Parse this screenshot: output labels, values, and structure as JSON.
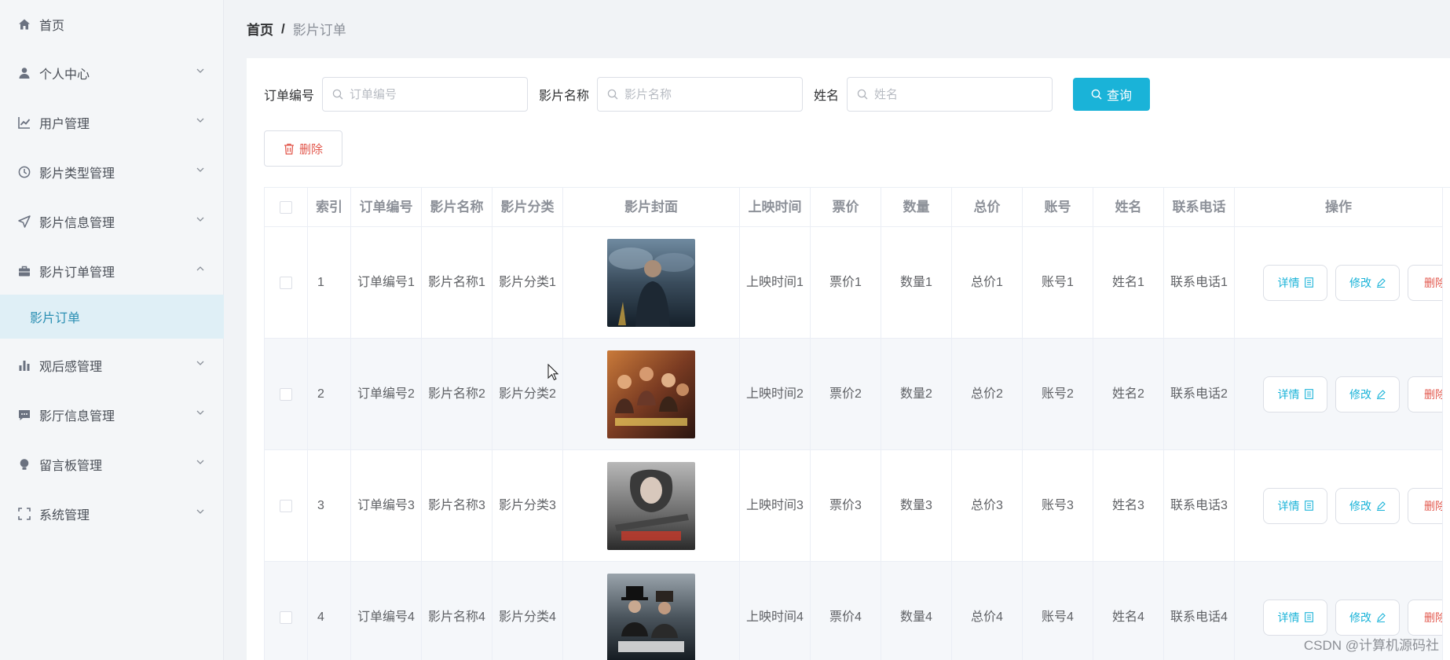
{
  "sidebar": {
    "items": [
      {
        "label": "首页",
        "icon": "home-icon"
      },
      {
        "label": "个人中心",
        "icon": "user-icon"
      },
      {
        "label": "用户管理",
        "icon": "chart-line-icon"
      },
      {
        "label": "影片类型管理",
        "icon": "clock-icon"
      },
      {
        "label": "影片信息管理",
        "icon": "send-icon"
      },
      {
        "label": "影片订单管理",
        "icon": "briefcase-icon"
      },
      {
        "label": "观后感管理",
        "icon": "bar-chart-icon"
      },
      {
        "label": "影厅信息管理",
        "icon": "chat-icon"
      },
      {
        "label": "留言板管理",
        "icon": "bulb-icon"
      },
      {
        "label": "系统管理",
        "icon": "fullscreen-icon"
      }
    ],
    "active_sub": "影片订单"
  },
  "breadcrumb": {
    "home": "首页",
    "separator": "/",
    "current": "影片订单"
  },
  "search": {
    "order_no_label": "订单编号",
    "order_no_placeholder": "订单编号",
    "movie_name_label": "影片名称",
    "movie_name_placeholder": "影片名称",
    "name_label": "姓名",
    "name_placeholder": "姓名",
    "query_label": "查询"
  },
  "toolbar": {
    "delete_label": "删除"
  },
  "table": {
    "headers": [
      "",
      "索引",
      "订单编号",
      "影片名称",
      "影片分类",
      "影片封面",
      "上映时间",
      "票价",
      "数量",
      "总价",
      "账号",
      "姓名",
      "联系电话",
      "操作"
    ],
    "rows": [
      {
        "index": "1",
        "order_no": "订单编号1",
        "movie_name": "影片名称1",
        "category": "影片分类1",
        "release": "上映时间1",
        "price": "票价1",
        "qty": "数量1",
        "total": "总价1",
        "account": "账号1",
        "name": "姓名1",
        "phone": "联系电话1"
      },
      {
        "index": "2",
        "order_no": "订单编号2",
        "movie_name": "影片名称2",
        "category": "影片分类2",
        "release": "上映时间2",
        "price": "票价2",
        "qty": "数量2",
        "total": "总价2",
        "account": "账号2",
        "name": "姓名2",
        "phone": "联系电话2"
      },
      {
        "index": "3",
        "order_no": "订单编号3",
        "movie_name": "影片名称3",
        "category": "影片分类3",
        "release": "上映时间3",
        "price": "票价3",
        "qty": "数量3",
        "total": "总价3",
        "account": "账号3",
        "name": "姓名3",
        "phone": "联系电话3"
      },
      {
        "index": "4",
        "order_no": "订单编号4",
        "movie_name": "影片名称4",
        "category": "影片分类4",
        "release": "上映时间4",
        "price": "票价4",
        "qty": "数量4",
        "total": "总价4",
        "account": "账号4",
        "name": "姓名4",
        "phone": "联系电话4"
      }
    ],
    "actions": {
      "detail": "详情",
      "edit": "修改",
      "remove": "删除"
    }
  },
  "watermark": "CSDN @计算机源码社",
  "colors": {
    "accent": "#1ab3d8",
    "danger": "#e2574c",
    "active_bg": "#dfeff6"
  }
}
